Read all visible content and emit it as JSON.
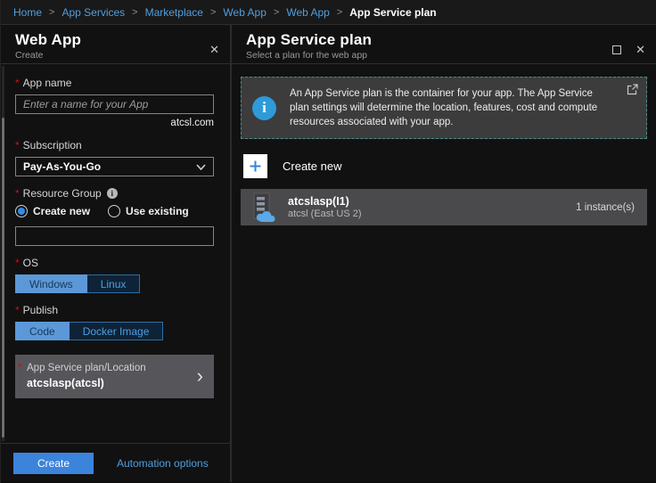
{
  "ui": {
    "required": "*",
    "separator": ">"
  },
  "icons": {
    "close": "✕",
    "chevron_right": "›",
    "info": "i"
  },
  "breadcrumb": {
    "items": [
      "Home",
      "App Services",
      "Marketplace",
      "Web App",
      "Web App"
    ],
    "current": "App Service plan"
  },
  "left_panel": {
    "title": "Web App",
    "subtitle": "Create",
    "app_name": {
      "label": "App name",
      "placeholder": "Enter a name for your App",
      "domain_suffix": "atcsl.com"
    },
    "subscription": {
      "label": "Subscription",
      "value": "Pay-As-You-Go"
    },
    "resource_group": {
      "label": "Resource Group",
      "option_create": "Create new",
      "option_existing": "Use existing",
      "selected": "Create new",
      "value": ""
    },
    "os": {
      "label": "OS",
      "option_windows": "Windows",
      "option_linux": "Linux",
      "selected": "Windows"
    },
    "publish": {
      "label": "Publish",
      "option_code": "Code",
      "option_docker": "Docker Image",
      "selected": "Code"
    },
    "app_service_plan": {
      "label": "App Service plan/Location",
      "value": "atcslasp(atcsl)"
    },
    "footer": {
      "create": "Create",
      "automation": "Automation options"
    }
  },
  "right_panel": {
    "title": "App Service plan",
    "subtitle": "Select a plan for the web app",
    "banner": {
      "text": "An App Service plan is the container for your app. The App Service plan settings will determine the location, features, cost and compute resources associated with your app."
    },
    "create_new": "Create new",
    "plans": [
      {
        "name": "atcslasp(I1)",
        "detail": "atcsl (East US 2)",
        "instances": "1 instance(s)"
      }
    ]
  },
  "colors": {
    "accent_blue": "#4f9fe0",
    "primary_button": "#3c83dc",
    "selected_toggle": "#5c98d8",
    "required_red": "#cc1111",
    "banner_border": "#4f8b8b",
    "plan_row_bg": "#4a4a4c",
    "asp_box_bg": "#55555a"
  }
}
